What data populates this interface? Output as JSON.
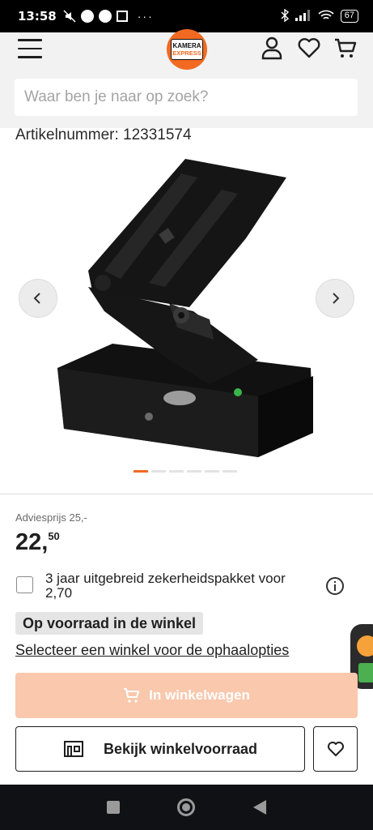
{
  "status_bar": {
    "time": "13:58",
    "dots": "···",
    "battery": "67"
  },
  "header": {
    "logo_line1": "KAMERA",
    "logo_line2": "EXPRESS",
    "search": {
      "placeholder": "Waar ben je naar op zoek?"
    },
    "icons": [
      "menu-icon",
      "user-icon",
      "heart-icon",
      "cart-icon"
    ]
  },
  "product": {
    "article_number": "Artikelnummer: 12331574",
    "image_count": 6,
    "active_image_index": 0,
    "advice_price": "Adviesprijs 25,-",
    "price_main": "22,",
    "price_cents": "50",
    "warranty_option": "3 jaar uitgebreid zekerheidspakket voor 2,70",
    "stock_status": "Op voorraad in de winkel",
    "store_link": "Selecteer een winkel voor de ophaalopties"
  },
  "actions": {
    "add_to_cart": "In winkelwagen",
    "view_store_stock": "Bekijk winkelvoorraad"
  },
  "colors": {
    "brand_orange": "#f26a21",
    "cart_button_disabled": "#f9c8ad",
    "header_bg": "#f2f2f2"
  }
}
